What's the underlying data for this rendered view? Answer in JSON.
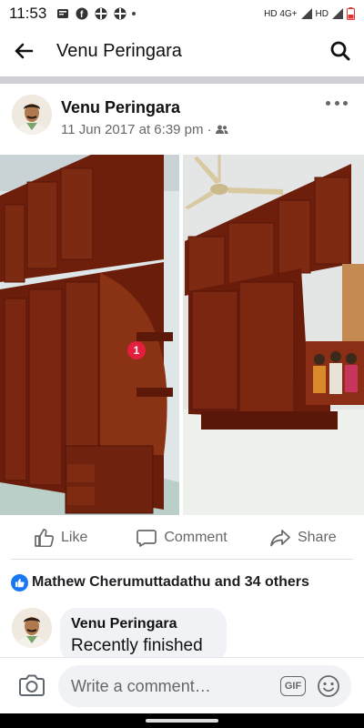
{
  "status_bar": {
    "time": "11:53",
    "network": "HD 4G+",
    "network2": "HD",
    "icons": [
      "news-icon",
      "facebook-icon",
      "game-icon",
      "game-icon",
      "dot-icon"
    ]
  },
  "header": {
    "title": "Venu Peringara",
    "back_icon": "arrow-left-icon",
    "search_icon": "search-icon"
  },
  "post": {
    "author": "Venu Peringara",
    "date": "11 Jun 2017 at 6:39 pm ·",
    "audience_icon": "friends-icon",
    "photos": [
      {
        "description_icon": "wardrobe-photo"
      },
      {
        "description_icon": "wardrobe-photo"
      }
    ],
    "notification_badge": "1"
  },
  "actions": {
    "like": "Like",
    "comment": "Comment",
    "share": "Share"
  },
  "reactions": {
    "text": "Mathew Cherumuttadathu and 34 others"
  },
  "comment": {
    "author": "Venu Peringara",
    "text": "Recently finished"
  },
  "composer": {
    "placeholder": "Write a comment…",
    "gif_label": "GIF"
  },
  "colors": {
    "accent": "#1877f2",
    "badge": "#e41e3f",
    "wood": "#7a2410"
  }
}
